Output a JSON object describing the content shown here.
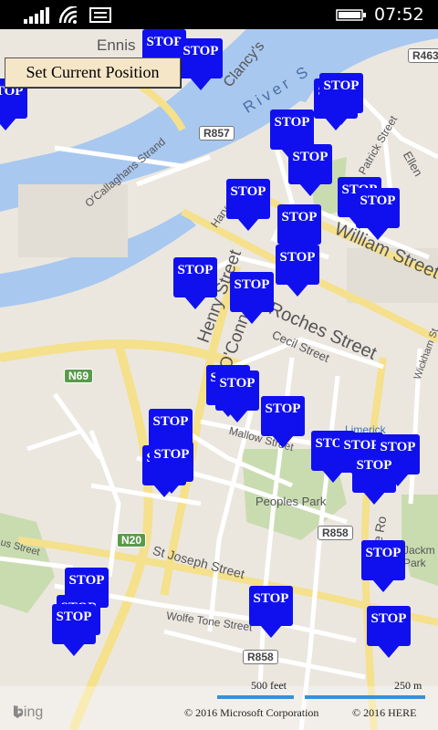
{
  "status_bar": {
    "time": "07:52"
  },
  "set_position_button": "Set Current Position",
  "stop_label": "STOP",
  "map_labels": {
    "ennis": "Ennis",
    "clancy": "Clancy's",
    "river_s": "River S",
    "patrick_street": "Patrick Street",
    "ellen": "Ellen",
    "ocallaghans": "O'Callaghans Strand",
    "harveys": "Harvey's",
    "william_street": "William Street",
    "henry_street": "Henry Street",
    "oconnell": "O'Conn",
    "roches_street": "Roches Street",
    "cecil_street": "Cecil Street",
    "wickham": "Wickham St",
    "mallow_street": "Mallow Street",
    "limerick": "Limerick",
    "peoples_park": "Peoples Park",
    "st_joseph_street": "St Joseph Street",
    "wolfe_tone_street": "Wolfe Tone Street",
    "jackman_park": "Jackm Park",
    "us_street": "us Street",
    "ade_road": "ade Ro"
  },
  "shields": {
    "r463": "R463",
    "r857": "R857",
    "n69": "N69",
    "n20": "N20",
    "r858_a": "R858",
    "r858_b": "R858"
  },
  "scale": {
    "feet": "500 feet",
    "meters": "250 m"
  },
  "footer": {
    "bing": "bing",
    "ms_copyright": "© 2016 Microsoft Corporation",
    "here_copyright": "© 2016 HERE"
  }
}
